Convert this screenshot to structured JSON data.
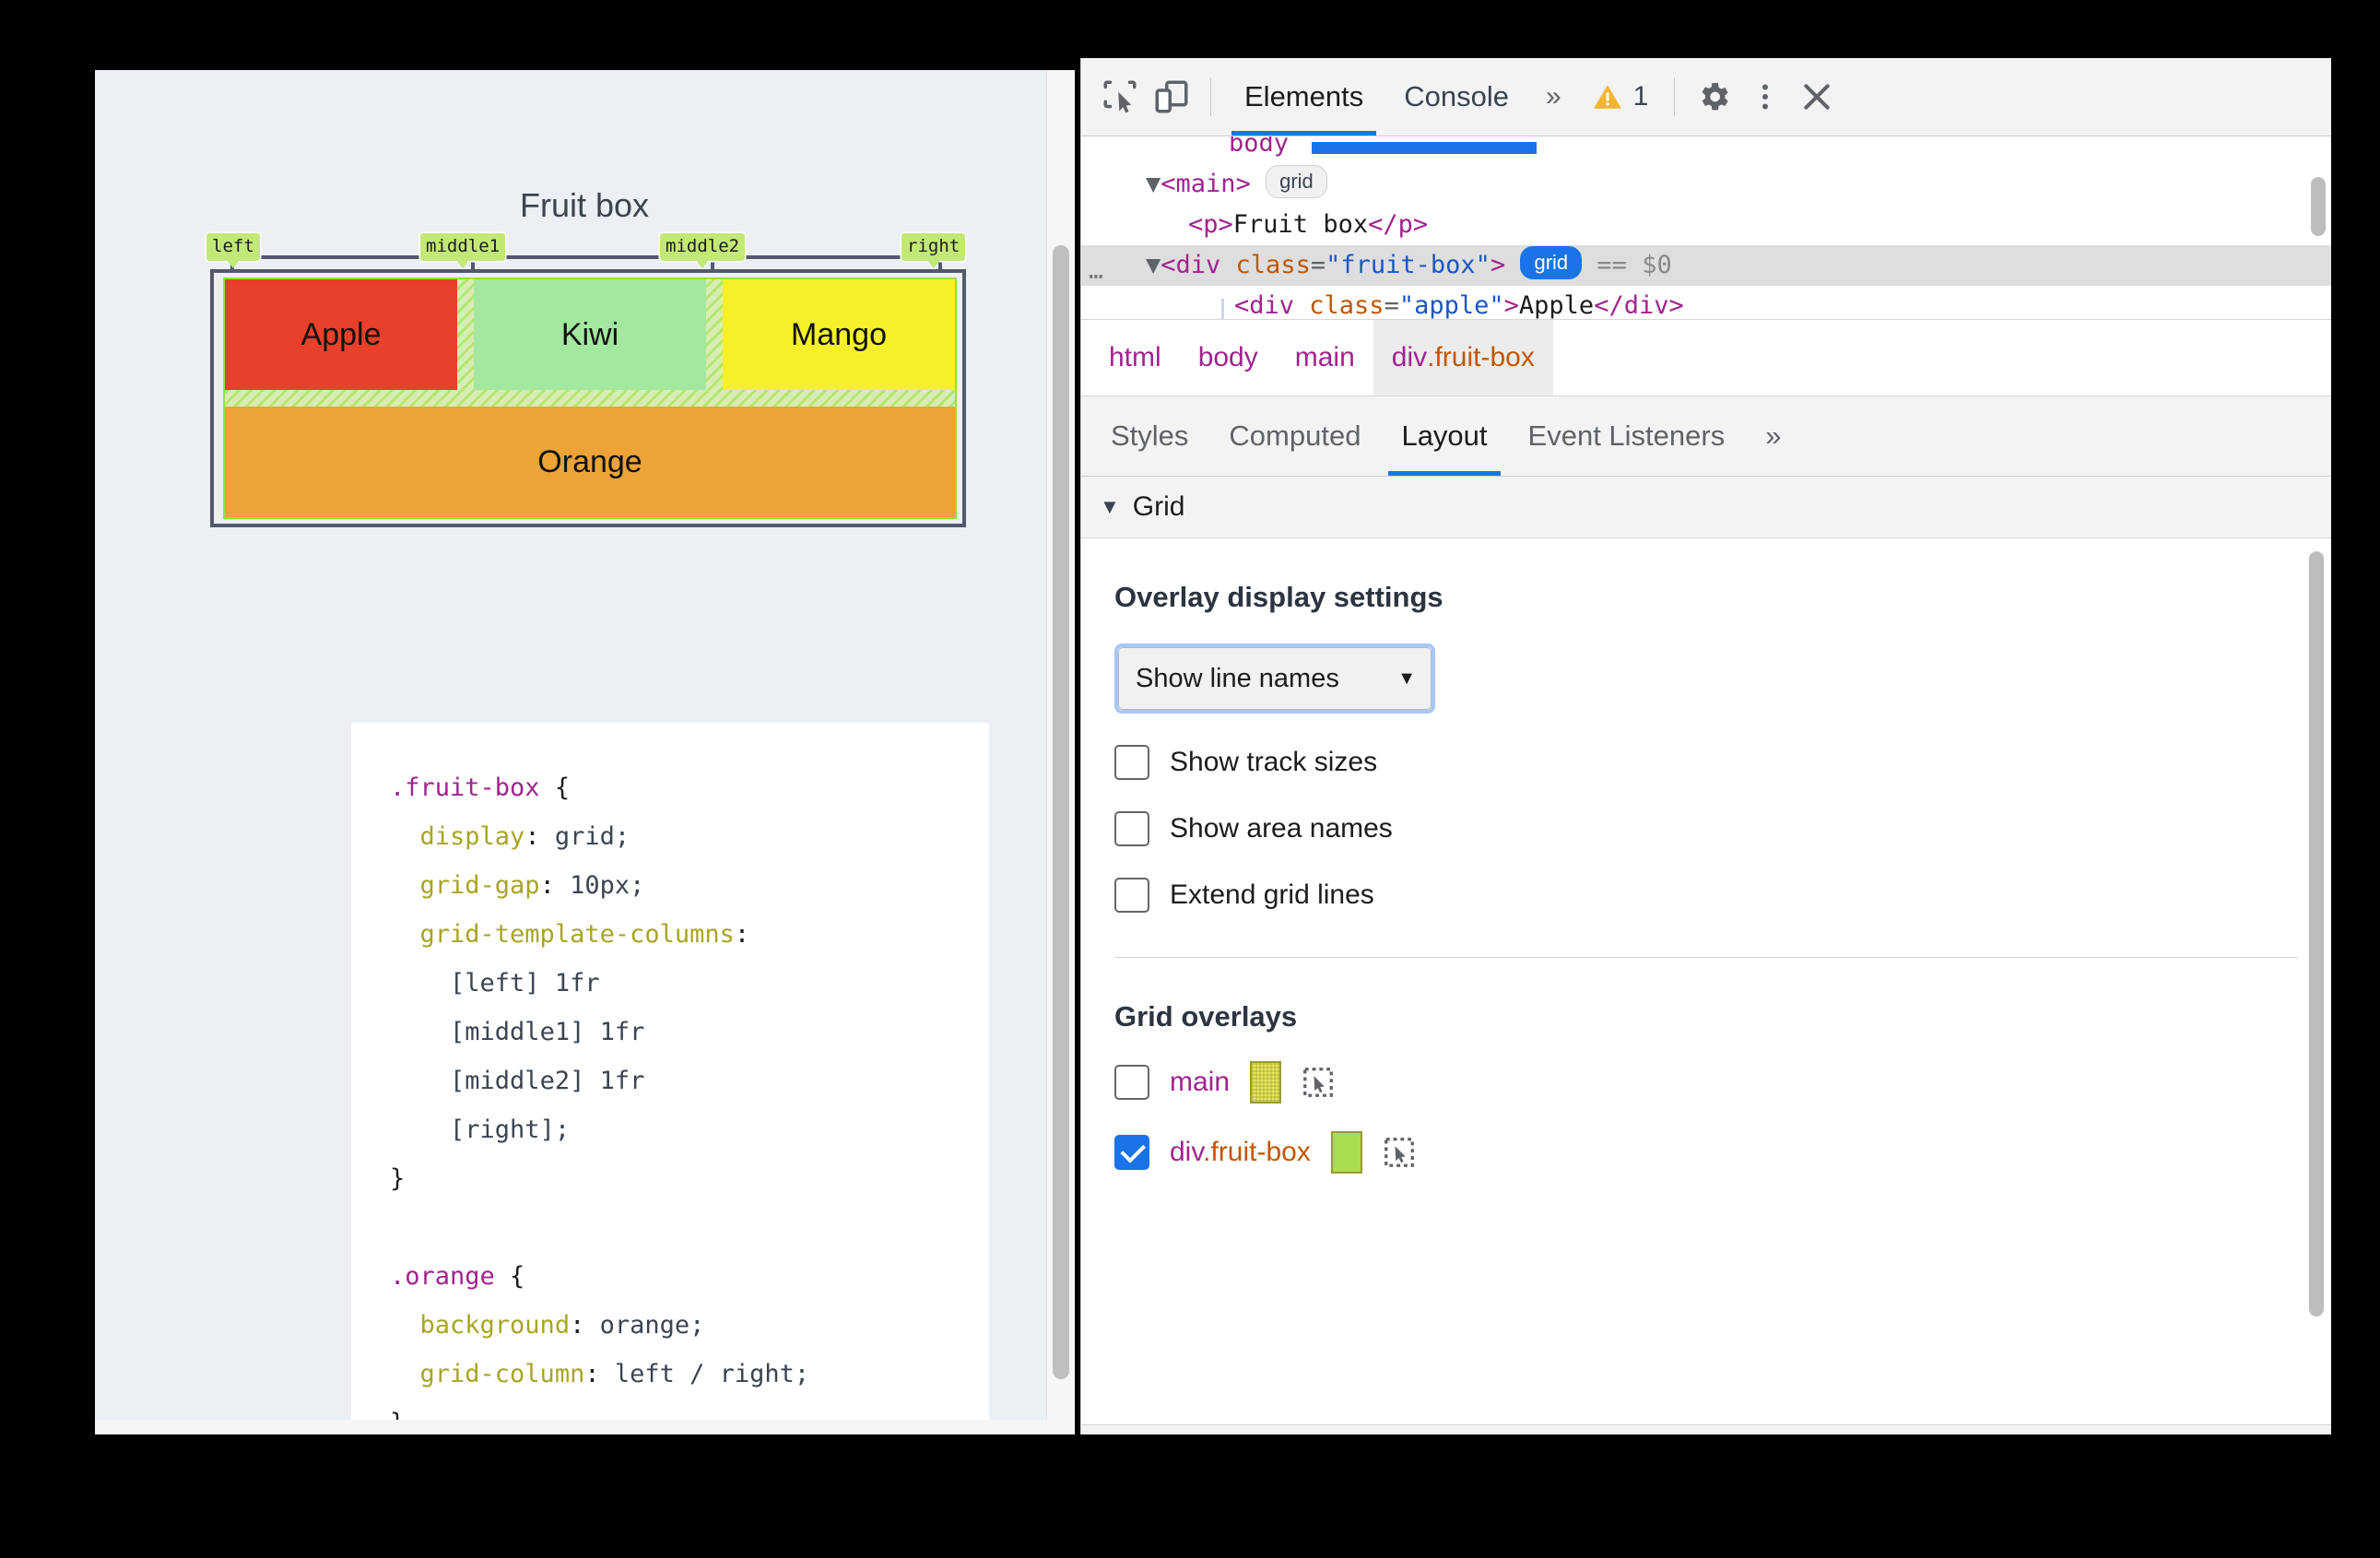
{
  "page": {
    "title": "Fruit box",
    "grid": {
      "line_names": [
        "left",
        "middle1",
        "middle2",
        "right"
      ],
      "cells": [
        {
          "label": "Apple",
          "color": "#e8402a"
        },
        {
          "label": "Kiwi",
          "color": "#a4e8a0"
        },
        {
          "label": "Mango",
          "color": "#f5f02a"
        },
        {
          "label": "Orange",
          "color": "#eca338"
        }
      ]
    },
    "code": {
      "rule1_selector": ".fruit-box",
      "rule1_lines": [
        "display: grid;",
        "grid-gap: 10px;",
        "grid-template-columns:",
        "[left] 1fr",
        "[middle1] 1fr",
        "[middle2] 1fr",
        "[right];"
      ],
      "rule2_selector": ".orange",
      "rule2_lines": [
        "background: orange;",
        "grid-column: left / right;"
      ]
    }
  },
  "devtools": {
    "toolbar": {
      "inspect_icon": "inspect-element-icon",
      "device_icon": "device-toolbar-icon",
      "tabs": [
        {
          "label": "Elements",
          "active": true
        },
        {
          "label": "Console",
          "active": false
        }
      ],
      "more_tabs": "»",
      "warning_count": "1",
      "settings_icon": "gear-icon",
      "menu_icon": "kebab-menu-icon",
      "close_icon": "close-icon"
    },
    "dom_tree": {
      "rows": [
        {
          "type": "partial",
          "text": "body"
        },
        {
          "type": "element",
          "indent": 1,
          "tag": "main",
          "badge": "grid",
          "badge_on": false
        },
        {
          "type": "text_node",
          "indent": 2,
          "tag": "p",
          "text": "Fruit box"
        },
        {
          "type": "selected",
          "indent": 1,
          "tag": "div",
          "attr": "class",
          "value": "fruit-box",
          "badge": "grid",
          "badge_on": true,
          "marker": "== $0"
        },
        {
          "type": "text_node",
          "indent": 2,
          "tag": "div",
          "attr": "class",
          "value": "apple",
          "text": "Apple"
        }
      ]
    },
    "breadcrumb": [
      {
        "label": "html",
        "active": false
      },
      {
        "label": "body",
        "active": false
      },
      {
        "label": "main",
        "active": false
      },
      {
        "label": "div",
        "cls": ".fruit-box",
        "active": true
      }
    ],
    "subtabs": [
      {
        "label": "Styles",
        "active": false
      },
      {
        "label": "Computed",
        "active": false
      },
      {
        "label": "Layout",
        "active": true
      },
      {
        "label": "Event Listeners",
        "active": false
      },
      {
        "label": "»",
        "active": false
      }
    ],
    "grid_section": {
      "header": "Grid",
      "caret": "▼",
      "overlay_settings_title": "Overlay display settings",
      "select_value": "Show line names",
      "select_caret": "▼",
      "checkboxes": [
        {
          "label": "Show track sizes",
          "checked": false
        },
        {
          "label": "Show area names",
          "checked": false
        },
        {
          "label": "Extend grid lines",
          "checked": false
        }
      ],
      "overlays_title": "Grid overlays",
      "overlays": [
        {
          "name": "main",
          "cls": "",
          "checked": false,
          "color": "#e7e95a",
          "swatch_style": "checkered",
          "pick_icon": "select-element-icon"
        },
        {
          "name": "div",
          "cls": ".fruit-box",
          "checked": true,
          "color": "#aadc4f",
          "swatch_style": "solid",
          "pick_icon": "select-element-icon"
        }
      ]
    }
  }
}
